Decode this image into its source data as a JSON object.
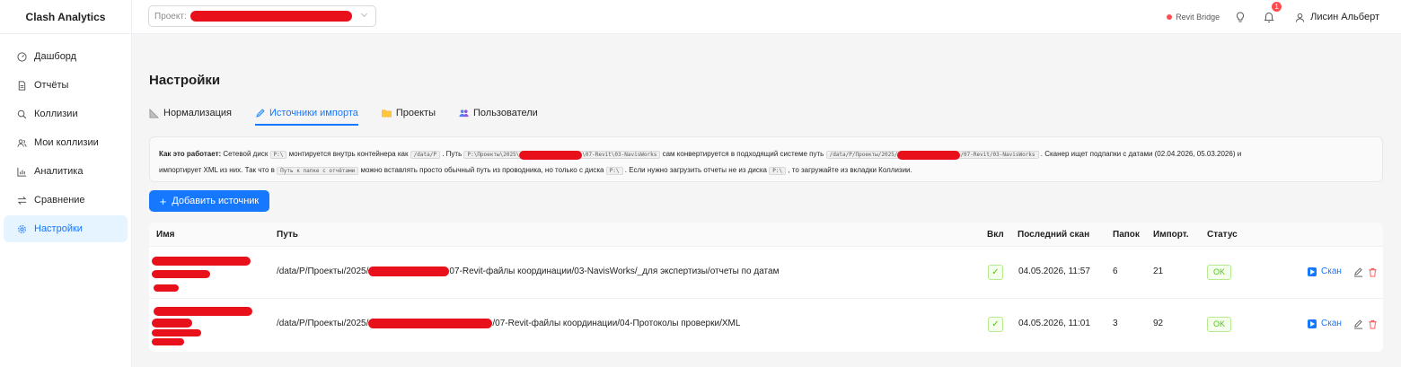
{
  "app": {
    "brand": "Clash Analytics"
  },
  "sidebar": {
    "items": [
      {
        "label": "Дашборд",
        "icon": "dashboard-icon"
      },
      {
        "label": "Отчёты",
        "icon": "file-icon"
      },
      {
        "label": "Коллизии",
        "icon": "search-icon"
      },
      {
        "label": "Мои коллизии",
        "icon": "users-icon"
      },
      {
        "label": "Аналитика",
        "icon": "bar-chart-icon"
      },
      {
        "label": "Сравнение",
        "icon": "swap-icon"
      },
      {
        "label": "Настройки",
        "icon": "gear-icon",
        "active": true
      }
    ]
  },
  "header": {
    "project_label": "Проект:",
    "bridge_label": "Revit Bridge",
    "notifications_count": "1",
    "user_name": "Лисин Альберт"
  },
  "page": {
    "title": "Настройки",
    "tabs": [
      {
        "label": "Нормализация",
        "icon": "ruler-icon"
      },
      {
        "label": "Источники импорта",
        "icon": "pen-icon",
        "active": true
      },
      {
        "label": "Проекты",
        "icon": "folder-icon"
      },
      {
        "label": "Пользователи",
        "icon": "team-icon"
      }
    ]
  },
  "info": {
    "bold": "Как это работает:",
    "t1": "Сетевой диск",
    "c1": "P:\\",
    "t2": "монтируется внутрь контейнера как",
    "c2": "/data/P",
    "t3": ". Путь",
    "c3a": "P:\\Проекты\\2025\\",
    "c3b": "\\07-Revit\\03-NavisWorks",
    "t4": "сам конвертируется в подходящий системе путь",
    "c4a": "/data/P/Проекты/2025/",
    "c4b": "/07-Revit/03-NavisWorks",
    "t5": ". Сканер ищет подпапки с датами (02.04.2026, 05.03.2026) и",
    "t6": "импортирует XML из них. Так что в",
    "c5": "Путь к папке с отчётами",
    "t7": "можно вставлять просто обычный путь из проводника, но только с диска",
    "c6": "P:\\",
    "t8": ". Если нужно загрузить отчеты не из диска",
    "c7": "P:\\",
    "t9": ", то загружайте из вкладки Коллизии."
  },
  "add_button": {
    "label": "Добавить источник"
  },
  "table": {
    "headers": {
      "name": "Имя",
      "path": "Путь",
      "enabled": "Вкл",
      "last_scan": "Последний скан",
      "folders": "Папок",
      "imported": "Импорт.",
      "status": "Статус"
    },
    "rows": [
      {
        "path_prefix": "/data/P/Проекты/2025/",
        "path_suffix": "07-Revit-файлы координации/03-NavisWorks/_для экспертизы/отчеты по датам",
        "enabled": true,
        "last_scan": "04.05.2026, 11:57",
        "folders": "6",
        "imported": "21",
        "status": "OK",
        "scan_label": "Скан"
      },
      {
        "path_prefix": "/data/P/Проекты/2025/",
        "path_suffix": "/07-Revit-файлы координации/04-Протоколы проверки/XML",
        "enabled": true,
        "last_scan": "04.05.2026, 11:01",
        "folders": "3",
        "imported": "92",
        "status": "OK",
        "scan_label": "Скан"
      }
    ]
  },
  "colors": {
    "accent": "#1677ff",
    "success": "#52c41a",
    "danger": "#ff4d4f",
    "redaction": "#e8101a"
  }
}
